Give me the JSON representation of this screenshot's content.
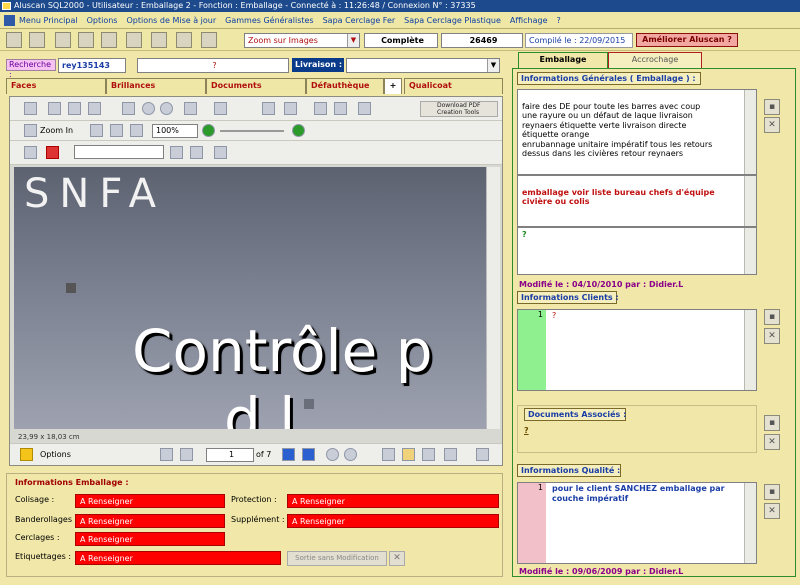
{
  "title_bar": "Aluscan SQL2000 - Utilisateur : Emballage 2 -  Fonction : Emballage -  Connecté à : 11:26:48 /  Connexion N° : 37335",
  "menu": [
    "Menu Principal",
    "Options",
    "Options de Mise à jour",
    "Gammes Généralistes",
    "Sapa Cerclage Fer",
    "Sapa Cerclage Plastique",
    "Affichage",
    "?"
  ],
  "toolbar": {
    "view_select": "Zoom sur Images",
    "status": "Complète",
    "number": "26469",
    "compiled": "Compilé le : 22/09/2015",
    "improve_button": "Améliorer Aluscan ?"
  },
  "search": {
    "label": "Recherche :",
    "value": "rey135143",
    "field2": "?",
    "livraison_label": "Livraison :",
    "livraison_value": ""
  },
  "left_tabs": [
    "Faces",
    "Brillances",
    "Documents",
    "Défauthèque",
    "+",
    "Qualicoat"
  ],
  "viewer": {
    "download_label": "Download PDF Creation Tools",
    "zoom_label": "Zoom In",
    "zoom_value": "100%",
    "doc_text1": "SNFA",
    "doc_text2": "Contrôle p",
    "doc_text3": "d    l",
    "page_size": "23,99 x 18,03 cm",
    "options_label": "Options",
    "page_current": "1",
    "page_total": "of 7"
  },
  "info_emballage": {
    "title": "Informations Emballage :",
    "colisage_label": "Colisage :",
    "colisage_value": "A Renseigner",
    "protection_label": "Protection :",
    "protection_value": "A Renseigner",
    "banderollage_label": "Banderollages :",
    "banderollage_value": "A Renseigner",
    "supplement_label": "Supplément :",
    "supplement_value": "A Renseigner",
    "cerclage_label": "Cerclages :",
    "cerclage_value": "A Renseigner",
    "etiquettage_label": "Etiquettages :",
    "etiquettage_value": "A Renseigner",
    "exit_button": "Sortie sans Modification"
  },
  "right_tabs": [
    "Emballage",
    "Accrochage"
  ],
  "infos_generales": {
    "title": "Informations Générales ( Emballage ) :",
    "text": "faire des DE pour toute les barres avec coup\nune rayure ou un défaut de laque livraison\nreynaers étiquette verte livraison directe\nétiquette orange\nenrubannage unitaire impératif  tous les retours\ndessus dans les civières retour reynaers",
    "text2": "emballage voir liste bureau chefs d'équipe\ncivière ou colis",
    "text3": "?",
    "modified": "Modifié le : 04/10/2010 par : Didier.L"
  },
  "infos_clients": {
    "title": "Informations Clients :",
    "line_no": "1",
    "text": "?"
  },
  "docs_associes": {
    "title": "Documents Associés :",
    "text": "?"
  },
  "infos_qualite": {
    "title": "Informations Qualité :",
    "line_no": "1",
    "text": "pour le client SANCHEZ emballage par\ncouche impératif",
    "modified": "Modifié le : 09/06/2009 par : Didier.L"
  }
}
